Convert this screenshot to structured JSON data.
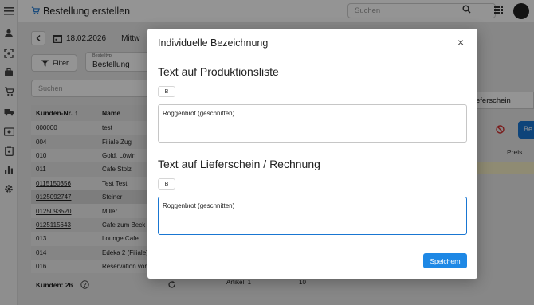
{
  "header": {
    "title": "Bestellung erstellen",
    "search_placeholder": "Suchen"
  },
  "order": {
    "date": "18.02.2026",
    "weekday": "Mittw",
    "filter_label": "Filter",
    "type_label": "Bestelltyp",
    "type_value": "Bestellung",
    "customer_search_placeholder": "Suchen"
  },
  "customers": {
    "columns": [
      "Kunden-Nr.",
      "Name"
    ],
    "sort_indicator": "↑",
    "rows": [
      {
        "nr": "000000",
        "name": "test",
        "link": false
      },
      {
        "nr": "004",
        "name": "Filiale Zug",
        "link": false
      },
      {
        "nr": "010",
        "name": "Gold. Löwin",
        "link": false
      },
      {
        "nr": "011",
        "name": "Cafe Stolz",
        "link": false
      },
      {
        "nr": "0115150356",
        "name": "Test Test",
        "link": true
      },
      {
        "nr": "0125092747",
        "name": "Steiner",
        "link": true
      },
      {
        "nr": "0125093520",
        "name": "Miller",
        "link": true
      },
      {
        "nr": "0125115643",
        "name": "Cafe zum Beck",
        "link": true
      },
      {
        "nr": "013",
        "name": "Lounge Cafe",
        "link": false
      },
      {
        "nr": "014",
        "name": "Edeka 2 (Filiale)",
        "link": false
      },
      {
        "nr": "016",
        "name": "Reservation vor",
        "link": false
      }
    ],
    "count_label": "Kunden: 26"
  },
  "right_panel": {
    "field_value": "eferschein",
    "button_label": "Be",
    "price_header": "Preis",
    "footer_articles": "Artikel: 1",
    "footer_qty": "10"
  },
  "modal": {
    "title": "Individuelle Bezeichnung",
    "section1_title": "Text auf Produktionsliste",
    "section1_bold": "B",
    "section1_text": "Roggenbrot (geschnitten)",
    "section2_title": "Text auf Lieferschein / Rechnung",
    "section2_bold": "B",
    "section2_text": "Roggenbrot (geschnitten)",
    "save_label": "Speichern",
    "close_icon": "×"
  },
  "colors": {
    "accent": "#1976d2",
    "danger": "#d32f2f",
    "highlight": "#f6efc6"
  }
}
